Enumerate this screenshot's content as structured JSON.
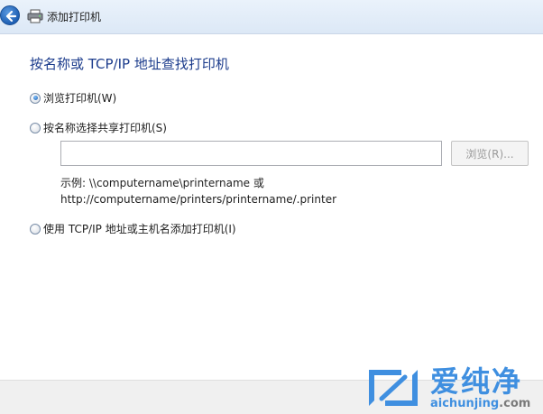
{
  "window": {
    "title": "添加打印机"
  },
  "heading": "按名称或 TCP/IP 地址查找打印机",
  "options": [
    {
      "label": "浏览打印机(W)",
      "checked": true
    },
    {
      "label": "按名称选择共享打印机(S)",
      "checked": false
    },
    {
      "label": "使用 TCP/IP 地址或主机名添加打印机(I)",
      "checked": false
    }
  ],
  "shared_printer": {
    "input_value": "",
    "browse_label": "浏览(R)...",
    "example_line1": "示例: \\\\computername\\printername 或",
    "example_line2": "http://computername/printers/printername/.printer"
  },
  "watermark": {
    "brand": "爱纯净",
    "url_main": "aichunjing",
    "url_tld": ".com"
  },
  "colors": {
    "heading": "#1c3c8c",
    "watermark": "#3f8fe0"
  }
}
